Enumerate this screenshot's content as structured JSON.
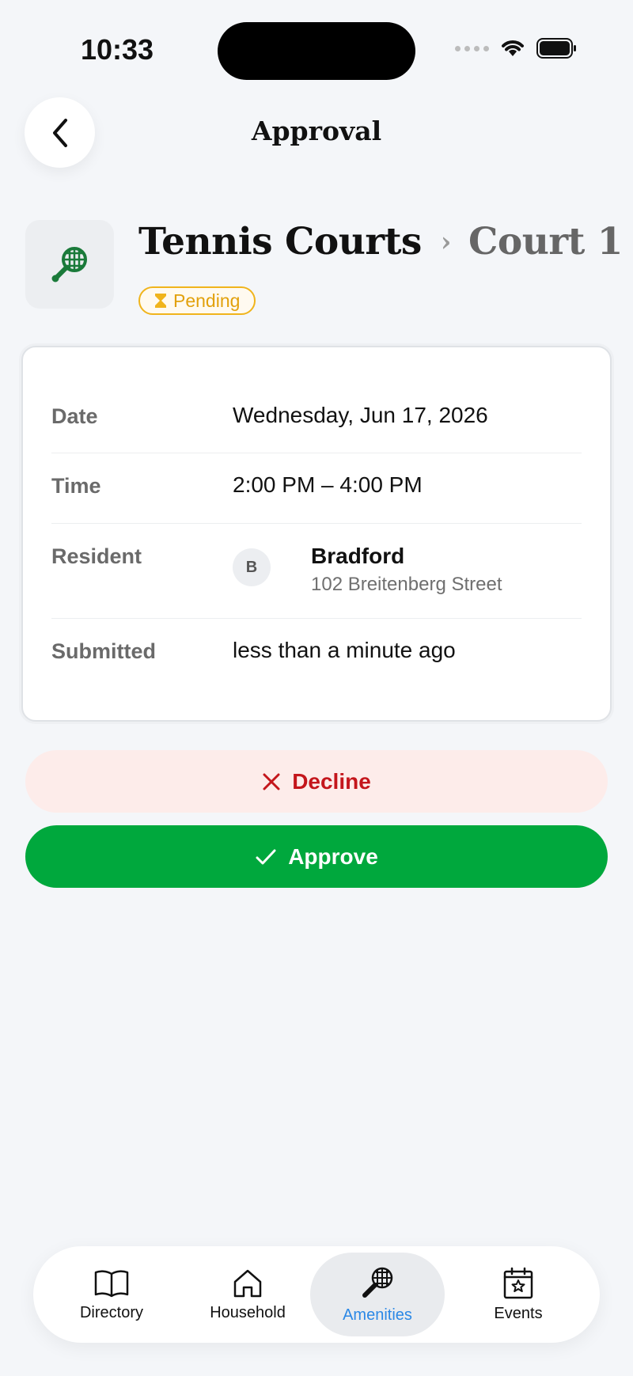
{
  "status_bar": {
    "time": "10:33"
  },
  "header": {
    "title": "Approval",
    "back_icon": "chevron-left-icon"
  },
  "amenity": {
    "icon": "tennis-racket-icon",
    "name": "Tennis Courts",
    "separator": "›",
    "court": "Court 1",
    "status": "Pending",
    "status_icon": "hourglass-icon",
    "accent_color": "#1a7a3a"
  },
  "details": {
    "date_label": "Date",
    "date_value": "Wednesday, Jun 17, 2026",
    "time_label": "Time",
    "time_value": "2:00 PM – 4:00 PM",
    "resident_label": "Resident",
    "resident_initial": "B",
    "resident_name": "Bradford",
    "resident_address": "102 Breitenberg Street",
    "submitted_label": "Submitted",
    "submitted_value": "less than a minute ago"
  },
  "actions": {
    "decline_label": "Decline",
    "approve_label": "Approve"
  },
  "tab_bar": {
    "tabs": [
      {
        "label": "Directory",
        "icon": "book-icon"
      },
      {
        "label": "Household",
        "icon": "house-icon"
      },
      {
        "label": "Amenities",
        "icon": "tennis-racket-icon",
        "active": true
      },
      {
        "label": "Events",
        "icon": "calendar-star-icon"
      }
    ]
  },
  "colors": {
    "approve": "#00a83d",
    "decline_text": "#c4161c",
    "decline_bg": "#fdecea",
    "pending": "#e2a10c",
    "active_tab": "#2b88e6"
  }
}
